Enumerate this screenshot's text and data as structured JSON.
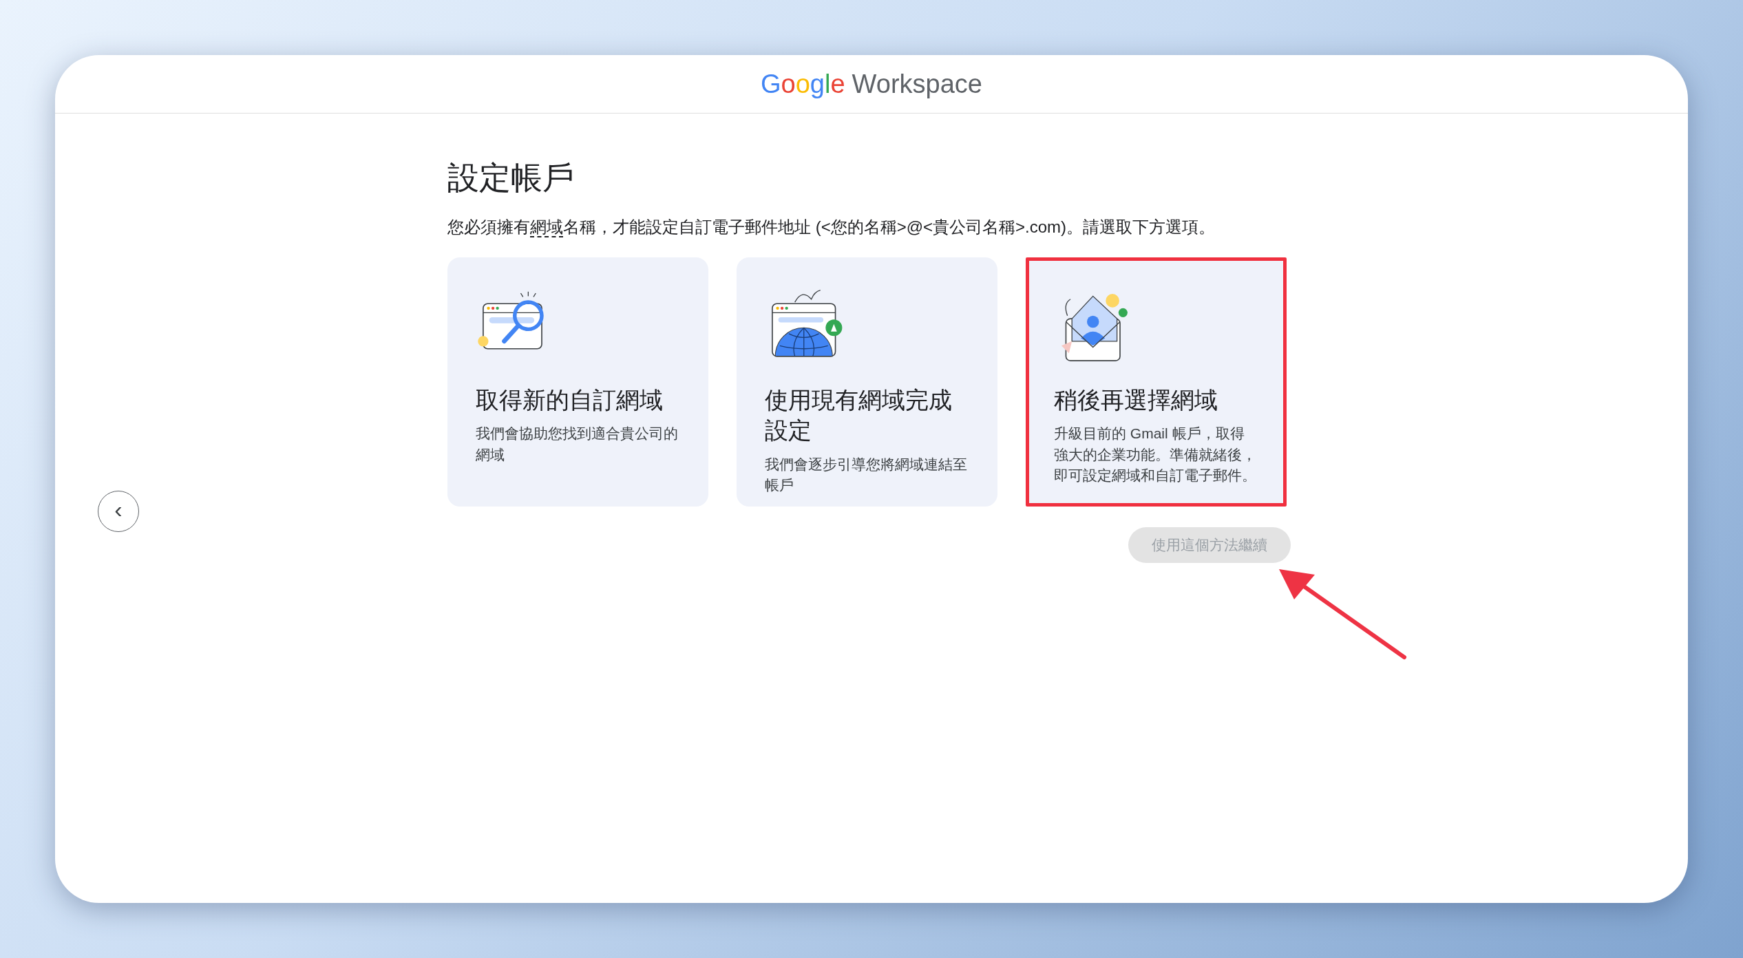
{
  "header": {
    "logo": {
      "brand": "Google",
      "product": "Workspace"
    }
  },
  "page": {
    "title": "設定帳戶",
    "description": {
      "before": "您必須擁有",
      "term": "網域",
      "after": "名稱，才能設定自訂電子郵件地址 (<您的名稱>@<貴公司名稱>.com)。請選取下方選項。"
    }
  },
  "back_button": {
    "label": "‹"
  },
  "options": [
    {
      "kind": "search",
      "title": "取得新的自訂網域",
      "description": "我們會協助您找到適合貴公司的網域",
      "annotated": false
    },
    {
      "kind": "globe",
      "title": "使用現有網域完成設定",
      "description": "我們會逐步引導您將網域連結至帳戶",
      "annotated": false
    },
    {
      "kind": "envelope",
      "title": "稍後再選擇網域",
      "description": "升級目前的 Gmail 帳戶，取得強大的企業功能。準備就緒後，即可設定網域和自訂電子郵件。",
      "annotated": true
    }
  ],
  "continue_button": {
    "label": "使用這個方法繼續",
    "disabled": true
  }
}
